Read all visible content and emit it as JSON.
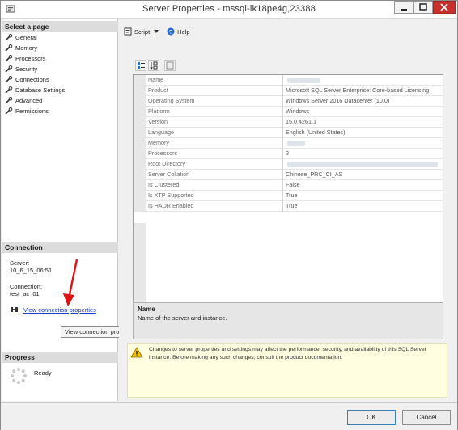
{
  "window": {
    "title": "Server Properties - mssql-lk18pe4g,23388"
  },
  "left": {
    "select_page_label": "Select a page",
    "pages": [
      {
        "label": "General",
        "icon": "wrench-icon"
      },
      {
        "label": "Memory",
        "icon": "wrench-icon"
      },
      {
        "label": "Processors",
        "icon": "wrench-icon"
      },
      {
        "label": "Security",
        "icon": "wrench-icon"
      },
      {
        "label": "Connections",
        "icon": "wrench-icon"
      },
      {
        "label": "Database Settings",
        "icon": "wrench-icon"
      },
      {
        "label": "Advanced",
        "icon": "wrench-icon"
      },
      {
        "label": "Permissions",
        "icon": "wrench-icon"
      }
    ],
    "connection": {
      "header": "Connection",
      "server_label": "Server:",
      "server_value": "10_6_15_06:51",
      "connection_label": "Connection:",
      "connection_value": "test_ac_01",
      "view_link": "View connection properties",
      "tooltip": "View connection properties"
    },
    "progress": {
      "header": "Progress",
      "status": "Ready"
    }
  },
  "toolbar": {
    "script_label": "Script",
    "help_label": "Help"
  },
  "grid": {
    "rows": [
      {
        "key": "Name",
        "value": "",
        "blurred": true
      },
      {
        "key": "Product",
        "value": "Microsoft SQL Server Enterprise: Core-based Licensing"
      },
      {
        "key": "Operating System",
        "value": "Windows Server 2016 Datacenter (10.0)"
      },
      {
        "key": "Platform",
        "value": "Windows"
      },
      {
        "key": "Version",
        "value": "15.0.4261.1"
      },
      {
        "key": "Language",
        "value": "English (United States)"
      },
      {
        "key": "Memory",
        "value": "",
        "blurred": true
      },
      {
        "key": "Processors",
        "value": "2"
      },
      {
        "key": "Root Directory",
        "value": "",
        "blurred": true
      },
      {
        "key": "Server Collation",
        "value": "Chinese_PRC_CI_AS"
      },
      {
        "key": "Is Clustered",
        "value": "False"
      },
      {
        "key": "Is XTP Supported",
        "value": "True"
      },
      {
        "key": "Is HADR Enabled",
        "value": "True"
      }
    ]
  },
  "description": {
    "title": "Name",
    "text": "Name of the server and instance."
  },
  "warning": {
    "text": "Changes to server properties and settings may affect the performance, security, and availability of this SQL Server instance. Before making any such changes, consult the product documentation."
  },
  "buttons": {
    "ok": "OK",
    "cancel": "Cancel"
  },
  "colors": {
    "link": "#1a3cc7",
    "close": "#c9302c",
    "warning_bg": "#fffee0"
  }
}
